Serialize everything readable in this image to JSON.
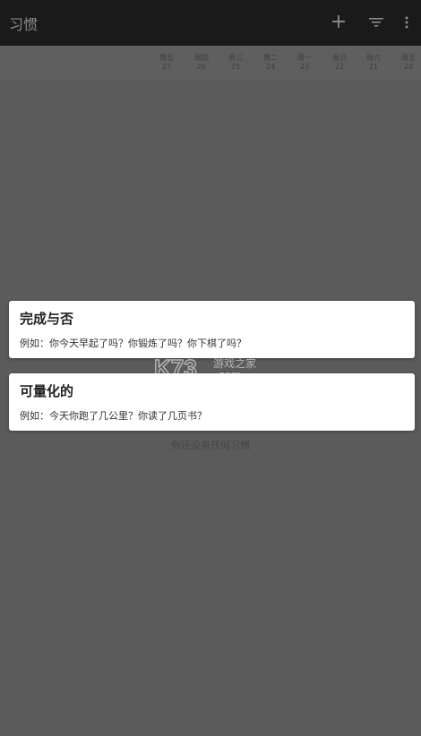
{
  "app_bar": {
    "title": "习惯",
    "add_icon": "plus-icon",
    "filter_icon": "filter-icon",
    "more_icon": "more-vert-icon"
  },
  "day_header": [
    {
      "weekday": "周五",
      "date": "27"
    },
    {
      "weekday": "周四",
      "date": "26"
    },
    {
      "weekday": "周三",
      "date": "25"
    },
    {
      "weekday": "周二",
      "date": "24"
    },
    {
      "weekday": "周一",
      "date": "23"
    },
    {
      "weekday": "周日",
      "date": "22"
    },
    {
      "weekday": "周六",
      "date": "21"
    },
    {
      "weekday": "周五",
      "date": "20"
    }
  ],
  "dialog_options": [
    {
      "title": "完成与否",
      "description": "例如：你今天早起了吗？你锻炼了吗？你下棋了吗？"
    },
    {
      "title": "可量化的",
      "description": "例如：今天你跑了几公里？你读了几页书？"
    }
  ],
  "empty_state": "你还没有任何习惯",
  "watermark": {
    "brand": "K73",
    "text": "游戏之家",
    "domain": ".com"
  },
  "colors": {
    "app_bar_bg": "#1a1a1a",
    "scrim_bg": "#5b5b5b",
    "card_bg": "#ffffff"
  }
}
